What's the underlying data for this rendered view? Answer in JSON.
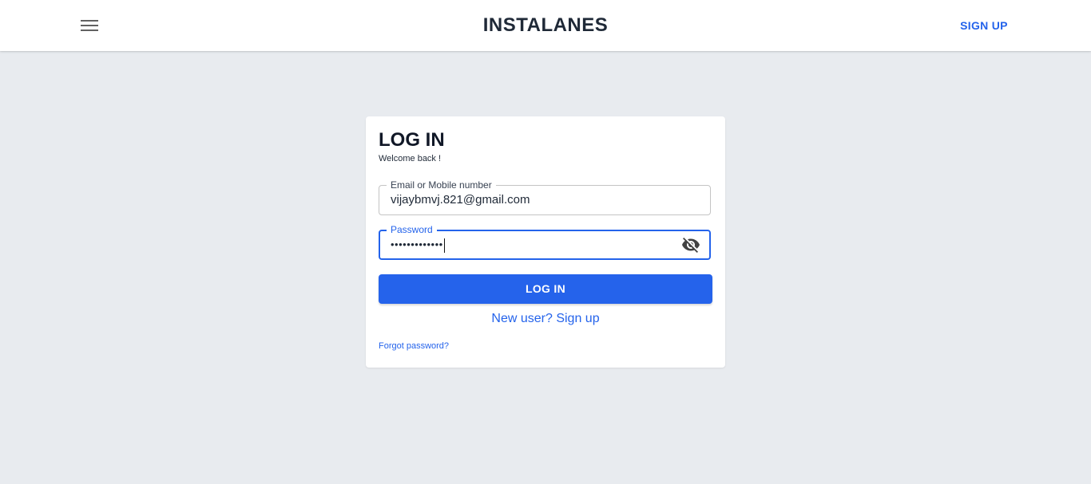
{
  "header": {
    "brand": "INSTALANES",
    "signup_label": "SIGN UP",
    "menu_icon": "menu-icon"
  },
  "login": {
    "title": "LOG IN",
    "subtitle": "Welcome back !",
    "email": {
      "label": "Email or Mobile number",
      "value": "vijaybmvj.821@gmail.com"
    },
    "password": {
      "label": "Password",
      "value": "•••••••••••••",
      "toggle_icon": "visibility-off-icon"
    },
    "submit_label": "LOG IN",
    "signup_link": "New user? Sign up",
    "forgot_link": "Forgot password?"
  },
  "colors": {
    "accent": "#2563eb",
    "background": "#e8ebef",
    "surface": "#ffffff"
  }
}
